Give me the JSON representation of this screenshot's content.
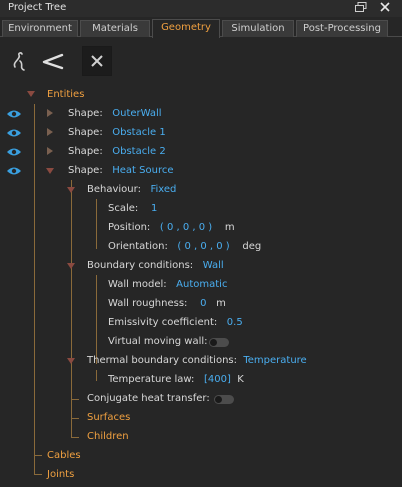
{
  "window": {
    "title": "Project Tree"
  },
  "tabs": [
    {
      "label": "Environment"
    },
    {
      "label": "Materials"
    },
    {
      "label": "Geometry"
    },
    {
      "label": "Simulation"
    },
    {
      "label": "Post-Processing"
    }
  ],
  "active_tab": "Geometry",
  "tree": {
    "entities": "Entities",
    "shapes": [
      {
        "prefix": "Shape:",
        "name": "OuterWall"
      },
      {
        "prefix": "Shape:",
        "name": "Obstacle 1"
      },
      {
        "prefix": "Shape:",
        "name": "Obstacle 2"
      },
      {
        "prefix": "Shape:",
        "name": "Heat Source"
      }
    ],
    "behaviour": {
      "label": "Behaviour:",
      "value": "Fixed"
    },
    "scale": {
      "label": "Scale:",
      "value": "1"
    },
    "position": {
      "label": "Position:",
      "value": "( 0 , 0 , 0 )",
      "unit": "m"
    },
    "orientation": {
      "label": "Orientation:",
      "value": "( 0 , 0 , 0 )",
      "unit": "deg"
    },
    "boundary": {
      "label": "Boundary conditions:",
      "value": "Wall"
    },
    "wall_model": {
      "label": "Wall model:",
      "value": "Automatic"
    },
    "wall_roughness": {
      "label": "Wall roughness:",
      "value": "0",
      "unit": "m"
    },
    "emissivity": {
      "label": "Emissivity coefficient:",
      "value": "0.5"
    },
    "virtual_moving_wall": {
      "label": "Virtual moving wall:",
      "on": false
    },
    "thermal": {
      "label": "Thermal boundary conditions:",
      "value": "Temperature"
    },
    "temperature_law": {
      "label": "Temperature law:",
      "value": "[400]",
      "unit": "K"
    },
    "conjugate": {
      "label": "Conjugate heat transfer:",
      "on": false
    },
    "surfaces": "Surfaces",
    "children": "Children",
    "cables": "Cables",
    "joints": "Joints"
  },
  "colors": {
    "accent_orange": "#f0a040",
    "value_blue": "#4aaef0",
    "eye_blue": "#3aa0e0"
  }
}
